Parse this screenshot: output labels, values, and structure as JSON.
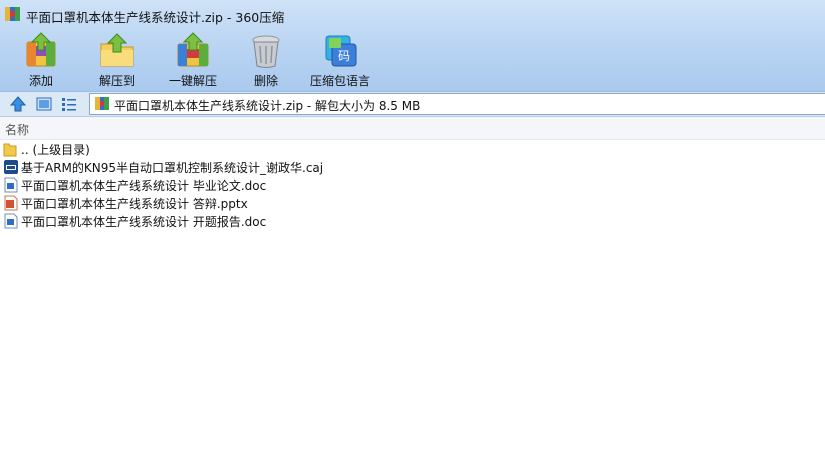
{
  "window": {
    "title": "平面口罩机本体生产线系统设计.zip - 360压缩"
  },
  "toolbar": {
    "buttons": [
      {
        "label": "添加",
        "icon": "add-archive-icon"
      },
      {
        "label": "解压到",
        "icon": "extract-to-icon"
      },
      {
        "label": "一键解压",
        "icon": "one-click-extract-icon"
      },
      {
        "label": "删除",
        "icon": "trash-icon"
      },
      {
        "label": "压缩包语言",
        "icon": "archive-language-icon"
      }
    ]
  },
  "address": {
    "text": "平面口罩机本体生产线系统设计.zip - 解包大小为 8.5 MB"
  },
  "list": {
    "column_name": "名称",
    "items": [
      {
        "name": ".. (上级目录)",
        "type": "parent-folder"
      },
      {
        "name": "基于ARM的KN95半自动口罩机控制系统设计_谢政华.caj",
        "type": "caj"
      },
      {
        "name": "平面口罩机本体生产线系统设计 毕业论文.doc",
        "type": "doc"
      },
      {
        "name": "平面口罩机本体生产线系统设计 答辩.pptx",
        "type": "pptx"
      },
      {
        "name": "平面口罩机本体生产线系统设计 开题报告.doc",
        "type": "doc"
      }
    ]
  }
}
